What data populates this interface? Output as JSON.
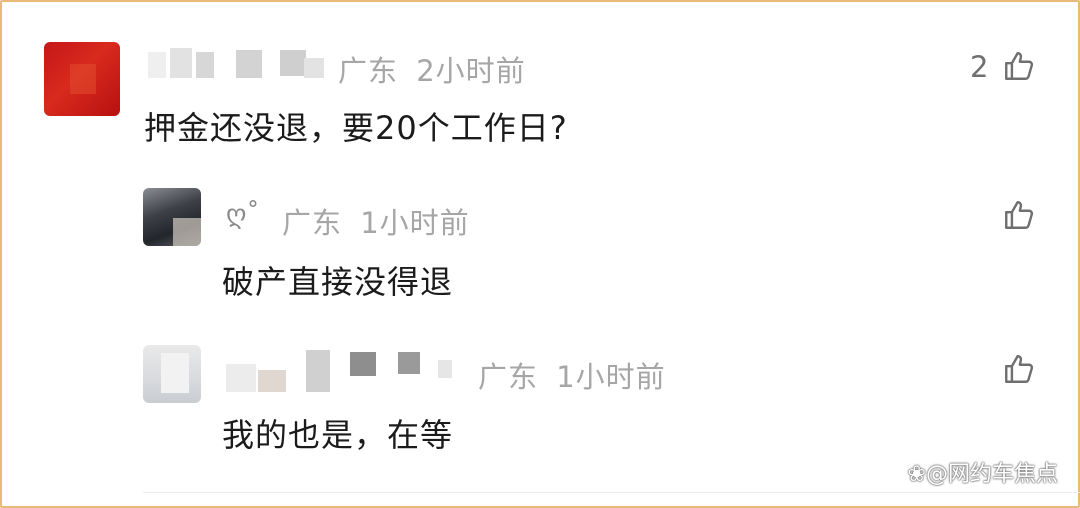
{
  "comments": [
    {
      "location": "广东",
      "time": "2小时前",
      "text": "押金还没退，要20个工作日?",
      "likes": "2",
      "replies": [
        {
          "nickname": "ღ˚",
          "location": "广东",
          "time": "1小时前",
          "text": "破产直接没得退"
        },
        {
          "location": "广东",
          "time": "1小时前",
          "text": "我的也是，在等"
        }
      ]
    }
  ],
  "watermark": "@网约车焦点",
  "icons": {
    "like": "thumbs-up-icon",
    "watermark_logo": "paw-icon"
  },
  "colors": {
    "border": "#e9b979",
    "meta_text": "#a6a6a6",
    "body_text": "#1b1b1b"
  }
}
